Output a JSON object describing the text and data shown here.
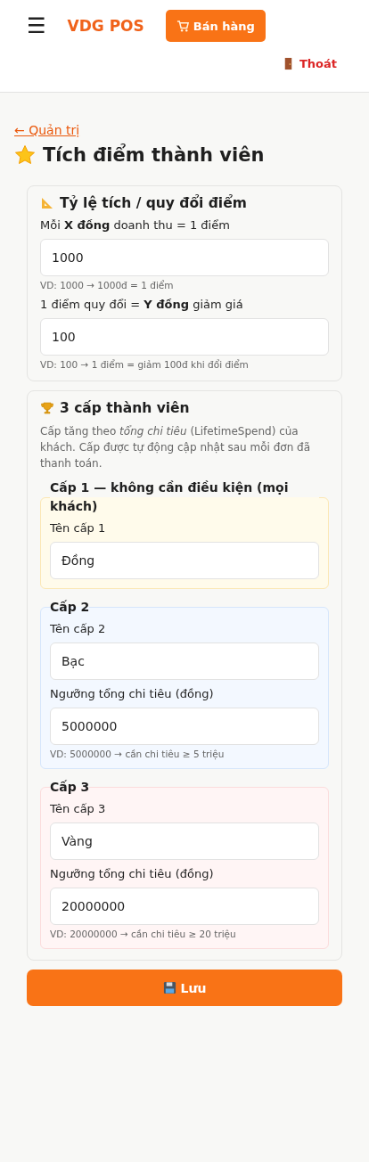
{
  "header": {
    "menu_icon": "☰",
    "logo": "VDG POS",
    "sell_button": "Bán hàng",
    "logout": "Thoát"
  },
  "back_link": "← Quản trị",
  "title": "Tích điểm thành viên",
  "rate_card": {
    "title": "Tỷ lệ tích / quy đổi điểm",
    "fields": [
      {
        "label": "Mỗi **X đồng** doanh thu = 1 điểm",
        "value": "1000",
        "hint": "VD: 1000 → 1000đ = 1 điểm"
      },
      {
        "label": "1 điểm quy đổi = **Y đồng** giảm giá",
        "value": "100",
        "hint": "VD: 100 → 1 điểm = giảm 100đ khi đổi điểm"
      }
    ]
  },
  "tier_card": {
    "title": "3 cấp thành viên",
    "description": "Cấp tăng theo *tổng chi tiêu* (LifetimeSpend) của khách. Cấp được tự động cập nhật sau mỗi đơn đã thanh toán.",
    "tiers": [
      {
        "legend": "Cấp 1 — không cần điều kiện (mọi khách)",
        "color": "#fffbeb",
        "fields": [
          {
            "label": "Tên cấp 1",
            "value": "Đồng"
          }
        ]
      },
      {
        "legend": "Cấp 2",
        "color": "#f3f8ff",
        "fields": [
          {
            "label": "Tên cấp 2",
            "value": "Bạc"
          },
          {
            "label": "Ngưỡng tổng chi tiêu (đồng)",
            "value": "5000000",
            "hint": "VD: 5000000 → cần chi tiêu ≥ 5 triệu"
          }
        ]
      },
      {
        "legend": "Cấp 3",
        "color": "#fff5f5",
        "fields": [
          {
            "label": "Tên cấp 3",
            "value": "Vàng"
          },
          {
            "label": "Ngưỡng tổng chi tiêu (đồng)",
            "value": "20000000",
            "hint": "VD: 20000000 → cần chi tiêu ≥ 20 triệu"
          }
        ]
      }
    ]
  },
  "save_button": "Lưu"
}
